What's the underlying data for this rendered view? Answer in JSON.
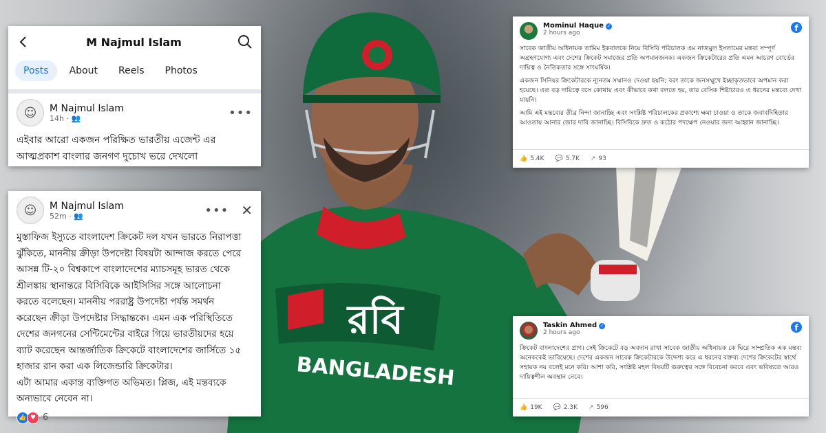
{
  "profile_card": {
    "back_icon": "back-arrow-icon",
    "title": "M Najmul Islam",
    "search_icon": "search-icon",
    "tabs": [
      "Posts",
      "About",
      "Reels",
      "Photos"
    ],
    "active_tab": "Posts"
  },
  "post1": {
    "author": "M Najmul Islam",
    "time": "14h",
    "audience_icon": "friends-icon",
    "menu": "•••",
    "text_line1": "এইবার আরো একজন পরিক্ষিত ভারতীয় এজেন্ট এর",
    "text_line2": "আত্মপ্রকাশ বাংলার জনগণ দুচোখ ভরে দেখলো"
  },
  "post2": {
    "author": "M Najmul Islam",
    "time": "52m",
    "audience_icon": "friends-icon",
    "menu": "•••",
    "close": "✕",
    "lines": [
      "মুস্তাফিজ ইস্যুতে বাংলাদেশ ক্রিকেট দল যখন ভারতে নিরাপত্তা",
      "ঝুঁকিতে, মাননীয় ক্রীড়া উপদেষ্টা বিষয়টা আন্দাজ করতে পেরে",
      "আসন্ন টি-২০ বিশ্বকাপে বাংলাদেশের ম্যাচসমূহ ভারত থেকে",
      "শ্রীলঙ্কায় স্থানান্তরে বিসিবিকে আইসিসির সঙ্গে আলোচনা",
      "করতে বলেছেন। মাননীয় পররাষ্ট্র উপদেষ্টা পর্যন্ত সমর্থন",
      "করেছেন ক্রীড়া উপদেষ্টার সিদ্ধান্তকে। এমন এক পরিস্থিতিতে",
      "দেশের জনগনের সেন্টিমেন্টের বাইরে গিয়ে ভারতীয়দের হয়ে",
      "ব্যাট করেছেন আন্তর্জাতিক ক্রিকেটে বাংলাদেশের জার্সিতে ১৫",
      "হাজার রান করা এক লিজেন্ডারি ক্রিকেটার।",
      "এটা আমার একান্ত ব্যক্তিগত অভিমত। প্লিজ, এই মন্তব্যকে",
      "অন্যভাবে নেবেন না।"
    ],
    "reaction_count": "6"
  },
  "mominul": {
    "name": "Mominul Haque",
    "time": "2 hours ago",
    "paragraphs": [
      "সাবেক জাতীয় অধিনায়ক তামিম ইকবালকে নিয়ে বিসিবি পরিচালক এম নাজমুল ইসলামের মন্তব্য সম্পূর্ণ অগ্রহণযোগ্য এবং দেশের ক্রিকেট সমাজের প্রতি অপমানজনক। একজন ক্রিকেটারের প্রতি এমন আচরণ বোর্ডের দায়িত্ব ও নৈতিকতার সঙ্গে সাংঘর্ষিক।",
      "একজন সিনিয়র ক্রিকেটারকে ন্যূনতম সম্মানও দেওয়া হয়নি; বরং তাকে জনসম্মুখে ইচ্ছাকৃতভাবে অপমান করা হয়েছে। এত বড় দায়িত্বে বসে কোথায় এবং কীভাবে কথা বলতে হয়, তার বেসিক শিষ্টাচারও এ ধরনের মন্তব্যে দেখা যায়নি।",
      "আমি এই মন্তব্যের তীব্র নিন্দা জানাচ্ছি এবং সংশ্লিষ্ট পরিচালকের প্রকাশ্যে ক্ষমা চাওয়া ও তাকে জবাবদিহিতার আওতায় আনার জোর দাবি জানাচ্ছি। বিসিবিকে দ্রুত ও কঠোর পদক্ষেপ নেওয়ার জন্য আহ্বান জানাচ্ছি।"
    ],
    "likes": "5.4K",
    "comments": "5.7K",
    "shares": "93"
  },
  "taskin": {
    "name": "Taskin Ahmed",
    "time": "2 hours ago",
    "paragraphs": [
      "ক্রিকেট বাংলাদেশের প্রাণ। সেই ক্রিকেটে বড় অবদান রাখা সাবেক জাতীয় অধিনায়ক কে ঘিরে সাম্প্রতিক এক মন্তব্য অনেককেই ভাবিয়েছে। দেশের একজন সাবেক ক্রিকেটারকে উদ্দেশ্য করে এ ধরনের বক্তব্য দেশের ক্রিকেটের স্বার্থে সহায়ক নয় বলেই মনে করি। আশা করি, সংশ্লিষ্ট মহল বিষয়টি গুরুত্বের সঙ্গে বিবেচনা করবে এবং ভবিষ্যতে আরও দায়িত্বশীল অবস্থান নেবে।"
    ],
    "likes": "19K",
    "comments": "2.3K",
    "shares": "596"
  },
  "jersey": {
    "sponsor": "রবি",
    "country": "BANGLADESH"
  },
  "colors": {
    "fb_blue": "#1877f2",
    "jersey_green": "#0f6b3c",
    "jersey_red": "#d01f2b"
  }
}
